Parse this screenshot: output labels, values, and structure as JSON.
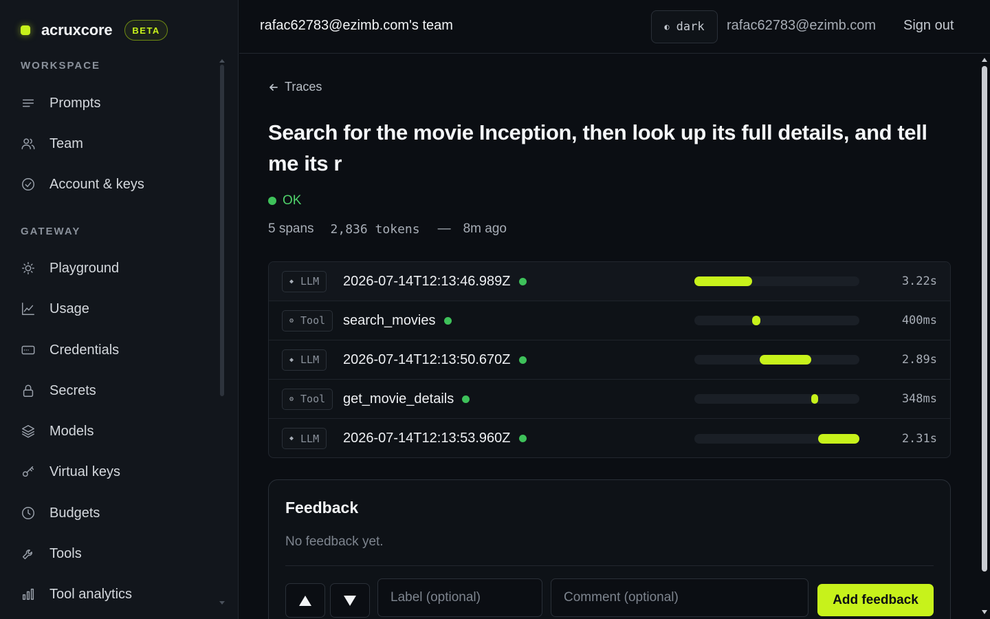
{
  "brand": {
    "name": "acruxcore",
    "badge": "BETA",
    "accent": "#c7f21b"
  },
  "sidebar": {
    "sections": [
      {
        "label": "WORKSPACE",
        "items": [
          {
            "label": "Prompts",
            "icon": "list-icon"
          },
          {
            "label": "Team",
            "icon": "users-icon"
          },
          {
            "label": "Account & keys",
            "icon": "check-circle-icon"
          }
        ]
      },
      {
        "label": "GATEWAY",
        "items": [
          {
            "label": "Playground",
            "icon": "sun-icon"
          },
          {
            "label": "Usage",
            "icon": "line-chart-icon"
          },
          {
            "label": "Credentials",
            "icon": "card-icon"
          },
          {
            "label": "Secrets",
            "icon": "lock-icon"
          },
          {
            "label": "Models",
            "icon": "layers-icon"
          },
          {
            "label": "Virtual keys",
            "icon": "key-icon"
          },
          {
            "label": "Budgets",
            "icon": "clock-icon"
          },
          {
            "label": "Tools",
            "icon": "wrench-icon"
          },
          {
            "label": "Tool analytics",
            "icon": "bar-chart-icon"
          }
        ]
      }
    ]
  },
  "header": {
    "team": "rafac62783@ezimb.com's team",
    "theme_glyph": "◐",
    "theme_label": "dark",
    "user_email": "rafac62783@ezimb.com",
    "sign_out": "Sign out"
  },
  "trace": {
    "back_label": "Traces",
    "title": "Search for the movie Inception, then look up its full details, and tell me its r",
    "status": "OK",
    "status_color": "#3ec15a",
    "spans_count": "5 spans",
    "tokens": "2,836 tokens",
    "separator": "—",
    "age": "8m ago"
  },
  "spans": [
    {
      "kind": "LLM",
      "kind_glyph": "◆",
      "name": "2026-07-14T12:13:46.989Z",
      "duration": "3.22s",
      "start_frac": 0.0,
      "width_frac": 0.35
    },
    {
      "kind": "Tool",
      "kind_glyph": "⚙",
      "name": "search_movies",
      "duration": "400ms",
      "start_frac": 0.35,
      "width_frac": 0.05
    },
    {
      "kind": "LLM",
      "kind_glyph": "◆",
      "name": "2026-07-14T12:13:50.670Z",
      "duration": "2.89s",
      "start_frac": 0.395,
      "width_frac": 0.315
    },
    {
      "kind": "Tool",
      "kind_glyph": "⚙",
      "name": "get_movie_details",
      "duration": "348ms",
      "start_frac": 0.71,
      "width_frac": 0.038
    },
    {
      "kind": "LLM",
      "kind_glyph": "◆",
      "name": "2026-07-14T12:13:53.960Z",
      "duration": "2.31s",
      "start_frac": 0.75,
      "width_frac": 0.25
    }
  ],
  "feedback": {
    "title": "Feedback",
    "empty": "No feedback yet.",
    "label_placeholder": "Label (optional)",
    "comment_placeholder": "Comment (optional)",
    "submit": "Add feedback"
  }
}
